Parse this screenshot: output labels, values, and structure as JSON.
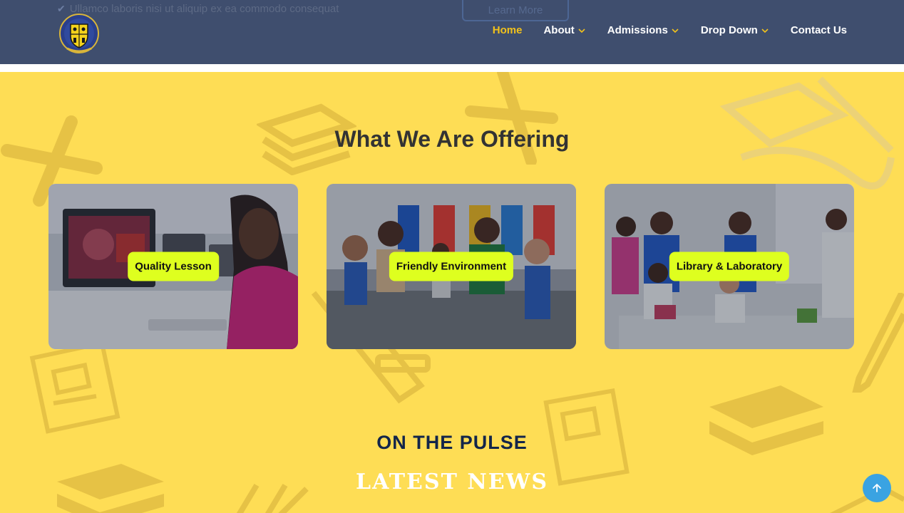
{
  "header": {
    "behind_text": "Ullamco laboris nisi ut aliquip ex ea commodo consequat",
    "behind_button": "Learn More",
    "nav": [
      {
        "label": "Home",
        "active": true,
        "dropdown": false
      },
      {
        "label": "About",
        "active": false,
        "dropdown": true
      },
      {
        "label": "Admissions",
        "active": false,
        "dropdown": true
      },
      {
        "label": "Drop Down",
        "active": false,
        "dropdown": true
      },
      {
        "label": "Contact Us",
        "active": false,
        "dropdown": false
      }
    ]
  },
  "offering": {
    "title": "What We Are Offering",
    "cards": [
      {
        "label": "Quality Lesson"
      },
      {
        "label": "Friendly Environment"
      },
      {
        "label": "Library & Laboratory"
      }
    ]
  },
  "news": {
    "heading": "ON THE PULSE",
    "subheading": "LATEST NEWS"
  },
  "colors": {
    "header_bg": "#3f4e6e",
    "nav_active": "#f2c21b",
    "section_bg": "#fedd55",
    "card_label_bg": "#deff1f",
    "back_to_top": "#3aa3e2"
  },
  "icons": [
    "check-icon",
    "school-crest-logo",
    "chevron-down-icon",
    "arrow-up-icon"
  ]
}
